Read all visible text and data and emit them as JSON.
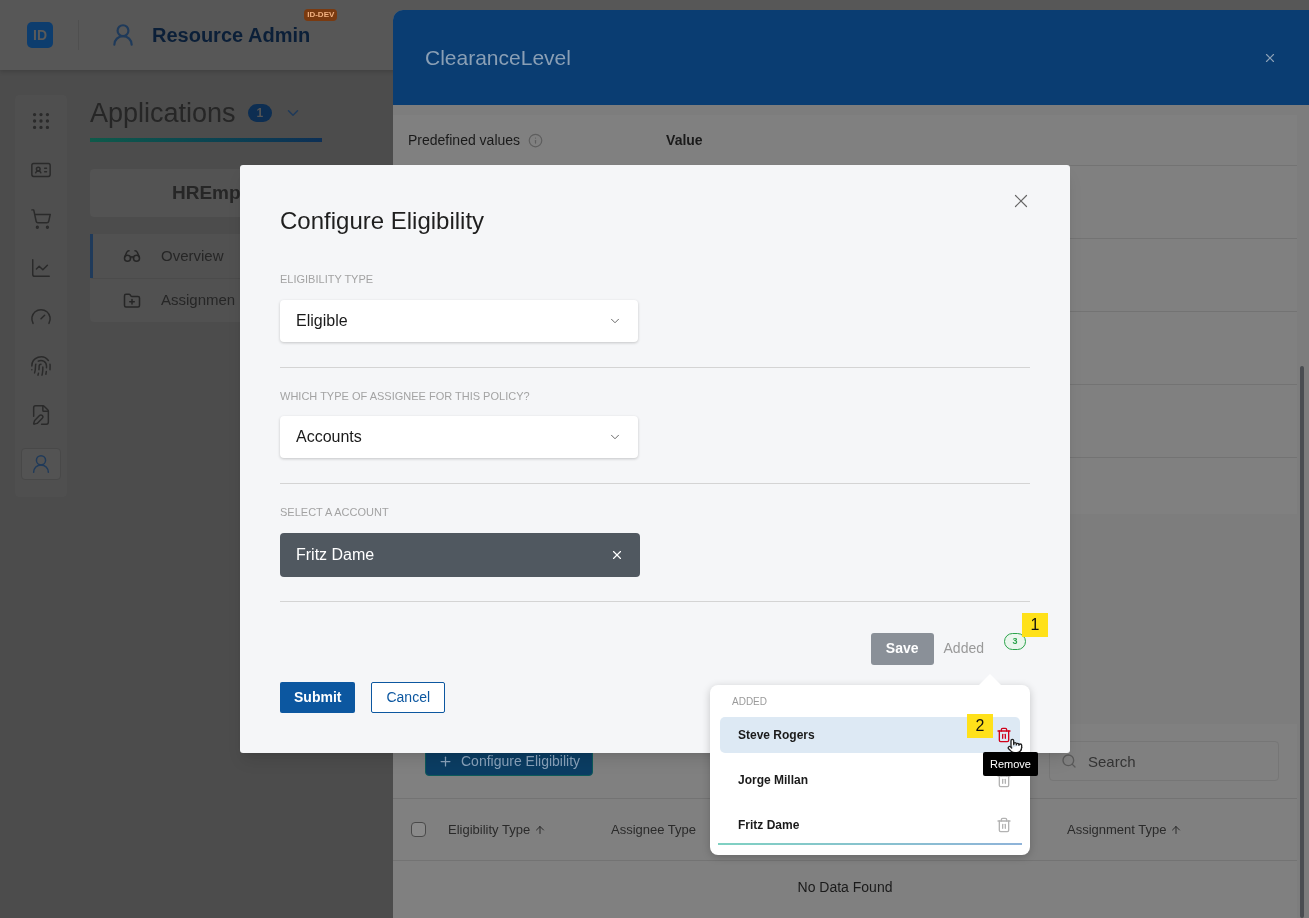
{
  "app": {
    "logo_text": "ID",
    "title": "Resource Admin",
    "env_badge": "ID-DEV"
  },
  "rail": [
    {
      "kind": "grid",
      "selected": false
    },
    {
      "kind": "id",
      "selected": false
    },
    {
      "kind": "cart",
      "selected": false
    },
    {
      "kind": "chart",
      "selected": false
    },
    {
      "kind": "gauge",
      "selected": false
    },
    {
      "kind": "fingerprint",
      "selected": false
    },
    {
      "kind": "document",
      "selected": false
    },
    {
      "kind": "person",
      "selected": true
    }
  ],
  "page": {
    "heading": "Applications",
    "count": "1",
    "card_title": "HREmp",
    "nav": [
      {
        "kind": "glasses",
        "label": "Overview",
        "selected": true
      },
      {
        "kind": "folder",
        "label": "Assignmen",
        "selected": false
      }
    ]
  },
  "drawer": {
    "title": "ClearanceLevel",
    "column_1": "Predefined values",
    "column_2": "Value",
    "add_button": "Configure Eligibility",
    "search": {
      "placeholder": "Search"
    },
    "columns": [
      {
        "label": "Eligibility Type",
        "sorted": true
      },
      {
        "label": "Assignee Type",
        "sorted": false
      },
      {
        "label": "Assignment Type",
        "sorted": true
      }
    ],
    "select_all": {
      "checked": false
    },
    "empty": "No Data Found"
  },
  "modal": {
    "title": "Configure Eligibility",
    "fields": [
      {
        "kind": "select",
        "label": "ELIGIBILITY TYPE",
        "value": "Eligible"
      },
      {
        "kind": "select",
        "label": "WHICH TYPE OF ASSIGNEE FOR THIS POLICY?",
        "value": "Accounts"
      },
      {
        "kind": "chip",
        "label": "SELECT A ACCOUNT",
        "value": "Fritz Dame"
      }
    ],
    "save": "Save",
    "added_label": "Added",
    "added_count": "3",
    "submit": "Submit",
    "cancel": "Cancel"
  },
  "popover": {
    "heading": "ADDED",
    "items": [
      {
        "name": "Steve Rogers",
        "selected": true
      },
      {
        "name": "Jorge Millan",
        "selected": false
      },
      {
        "name": "Fritz Dame",
        "selected": false
      }
    ]
  },
  "tooltip": "Remove",
  "callouts": [
    {
      "text": "1"
    },
    {
      "text": "2"
    }
  ]
}
